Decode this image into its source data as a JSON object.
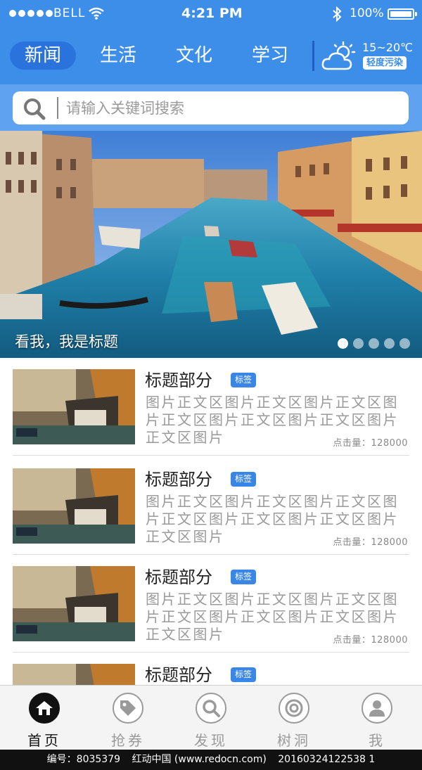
{
  "status_bar": {
    "carrier": "BELL",
    "time": "4:21 PM",
    "battery": "100%"
  },
  "tabs": [
    {
      "label": "新闻",
      "active": true
    },
    {
      "label": "生活",
      "active": false
    },
    {
      "label": "文化",
      "active": false
    },
    {
      "label": "学习",
      "active": false
    }
  ],
  "weather": {
    "icon": "partly-cloudy-icon",
    "temperature": "15~20℃",
    "air_quality": "轻度污染"
  },
  "search": {
    "placeholder": "请输入关键词搜索"
  },
  "banner": {
    "caption": "看我，我是标题",
    "slide_count": 5,
    "active_slide": 1
  },
  "list": {
    "items": [
      {
        "title": "标题部分",
        "tag": "标签",
        "body": "图片正文区图片正文区图片正文区图片正文区图片正文区图片正文区图片正文区图片",
        "meta": "点击量：128000"
      },
      {
        "title": "标题部分",
        "tag": "标签",
        "body": "图片正文区图片正文区图片正文区图片正文区图片正文区图片正文区图片正文区图片",
        "meta": "点击量：128000"
      },
      {
        "title": "标题部分",
        "tag": "标签",
        "body": "图片正文区图片正文区图片正文区图片正文区图片正文区图片正文区图片正文区图片",
        "meta": "点击量：128000"
      },
      {
        "title": "标题部分",
        "tag": "标签",
        "body": "",
        "meta": ""
      }
    ]
  },
  "bottom_nav": [
    {
      "label": "首页",
      "icon": "home-icon",
      "active": true
    },
    {
      "label": "抢券",
      "icon": "tag-icon",
      "active": false
    },
    {
      "label": "发现",
      "icon": "search-icon",
      "active": false
    },
    {
      "label": "树洞",
      "icon": "target-icon",
      "active": false
    },
    {
      "label": "我",
      "icon": "user-icon",
      "active": false
    }
  ],
  "footer": {
    "id_text": "编号：8035379",
    "site_text": "红动中国 (www.redocn.com)",
    "date_text": "20160324122538 1"
  },
  "colors": {
    "header_blue": "#3d8ee9",
    "active_tab": "#2a73dd",
    "tag_blue": "#3a86e6"
  }
}
